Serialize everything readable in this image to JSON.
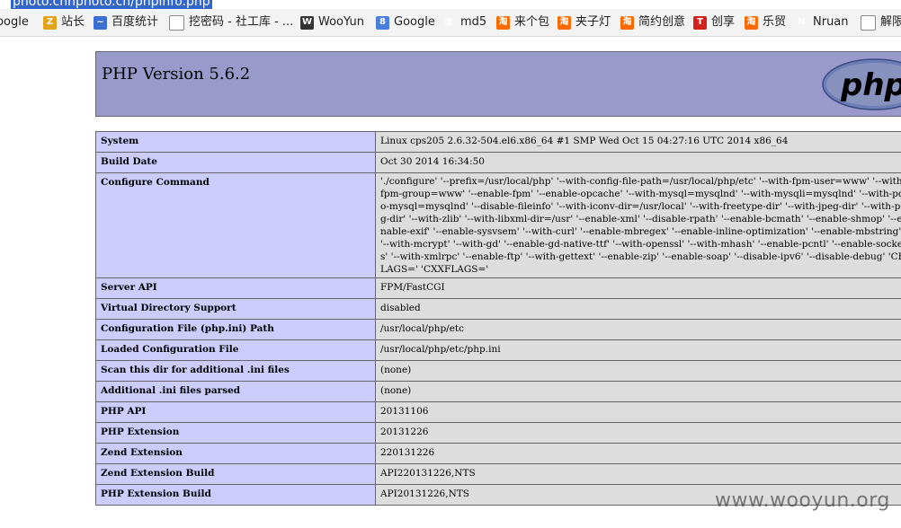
{
  "url_bar": {
    "url": "photo.chnphoto.cn/phpinfo.php"
  },
  "bookmarks": [
    {
      "label": "Google",
      "icon": "google-icon"
    },
    {
      "label": "站长",
      "icon": "webmaster-icon"
    },
    {
      "label": "百度统计",
      "icon": "chart-icon"
    },
    {
      "label": "挖密码 - 社工库 - ...",
      "icon": "page-icon"
    },
    {
      "label": "WooYun",
      "icon": "wooyun-icon"
    },
    {
      "label": "Google",
      "icon": "google-icon"
    },
    {
      "label": "md5",
      "icon": "grid-icon"
    },
    {
      "label": "来个包",
      "icon": "taobao-icon"
    },
    {
      "label": "夹子灯",
      "icon": "taobao-icon"
    },
    {
      "label": "简约创意",
      "icon": "taobao-icon"
    },
    {
      "label": "创享",
      "icon": "t-icon"
    },
    {
      "label": "乐贸",
      "icon": "taobao-icon"
    },
    {
      "label": "Nruan",
      "icon": "n-icon"
    },
    {
      "label": "解限",
      "icon": "page-icon"
    }
  ],
  "php": {
    "title": "PHP Version 5.6.2",
    "logo_text": "php"
  },
  "rows": [
    {
      "key": "System",
      "value": "Linux cps205 2.6.32-504.el6.x86_64 #1 SMP Wed Oct 15 04:27:16 UTC 2014 x86_64"
    },
    {
      "key": "Build Date",
      "value": "Oct 30 2014 16:34:50"
    },
    {
      "key": "Configure Command",
      "value": "'./configure' '--prefix=/usr/local/php' '--with-config-file-path=/usr/local/php/etc' '--with-fpm-user=www' '--with-fpm-group=www' '--enable-fpm' '--enable-opcache' '--with-mysql=mysqlnd' '--with-mysqli=mysqlnd' '--with-pdo-mysql=mysqlnd' '--disable-fileinfo' '--with-iconv-dir=/usr/local' '--with-freetype-dir' '--with-jpeg-dir' '--with-png-dir' '--with-zlib' '--with-libxml-dir=/usr' '--enable-xml' '--disable-rpath' '--enable-bcmath' '--enable-shmop' '--enable-exif' '--enable-sysvsem' '--with-curl' '--enable-mbregex' '--enable-inline-optimization' '--enable-mbstring' '--with-mcrypt' '--with-gd' '--enable-gd-native-ttf' '--with-openssl' '--with-mhash' '--enable-pcntl' '--enable-sockets' '--with-xmlrpc' '--enable-ftp' '--with-gettext' '--enable-zip' '--enable-soap' '--disable-ipv6' '--disable-debug' 'CFLAGS=' 'CXXFLAGS='",
      "multiline": true
    },
    {
      "key": "Server API",
      "value": "FPM/FastCGI"
    },
    {
      "key": "Virtual Directory Support",
      "value": "disabled"
    },
    {
      "key": "Configuration File (php.ini) Path",
      "value": "/usr/local/php/etc"
    },
    {
      "key": "Loaded Configuration File",
      "value": "/usr/local/php/etc/php.ini"
    },
    {
      "key": "Scan this dir for additional .ini files",
      "value": "(none)"
    },
    {
      "key": "Additional .ini files parsed",
      "value": "(none)"
    },
    {
      "key": "PHP API",
      "value": "20131106"
    },
    {
      "key": "PHP Extension",
      "value": "20131226"
    },
    {
      "key": "Zend Extension",
      "value": "220131226"
    },
    {
      "key": "Zend Extension Build",
      "value": "API220131226,NTS"
    },
    {
      "key": "PHP Extension Build",
      "value": "API20131226,NTS"
    }
  ],
  "watermark": "www.wooyun.org",
  "colors": {
    "header": "#9999cc",
    "key_cell": "#ccccff",
    "value_cell": "#dddddd"
  }
}
